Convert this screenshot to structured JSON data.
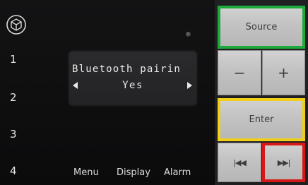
{
  "display": {
    "line1": "Bluetooth pairin",
    "line2": "Yes"
  },
  "presets": [
    "1",
    "2",
    "3",
    "4"
  ],
  "soft_buttons": {
    "menu": "Menu",
    "display": "Display",
    "alarm": "Alarm"
  },
  "buttons": {
    "source": "Source",
    "minus": "−",
    "plus": "+",
    "enter": "Enter",
    "prev": "|◀◀",
    "next": "▶▶|"
  },
  "icons": {
    "logo": "cube-logo-icon",
    "arrow_left": "arrow-left-icon",
    "arrow_right": "arrow-right-icon"
  },
  "highlight_colors": {
    "green": "#1faa3c",
    "yellow": "#f0cf19",
    "red": "#d61818"
  }
}
